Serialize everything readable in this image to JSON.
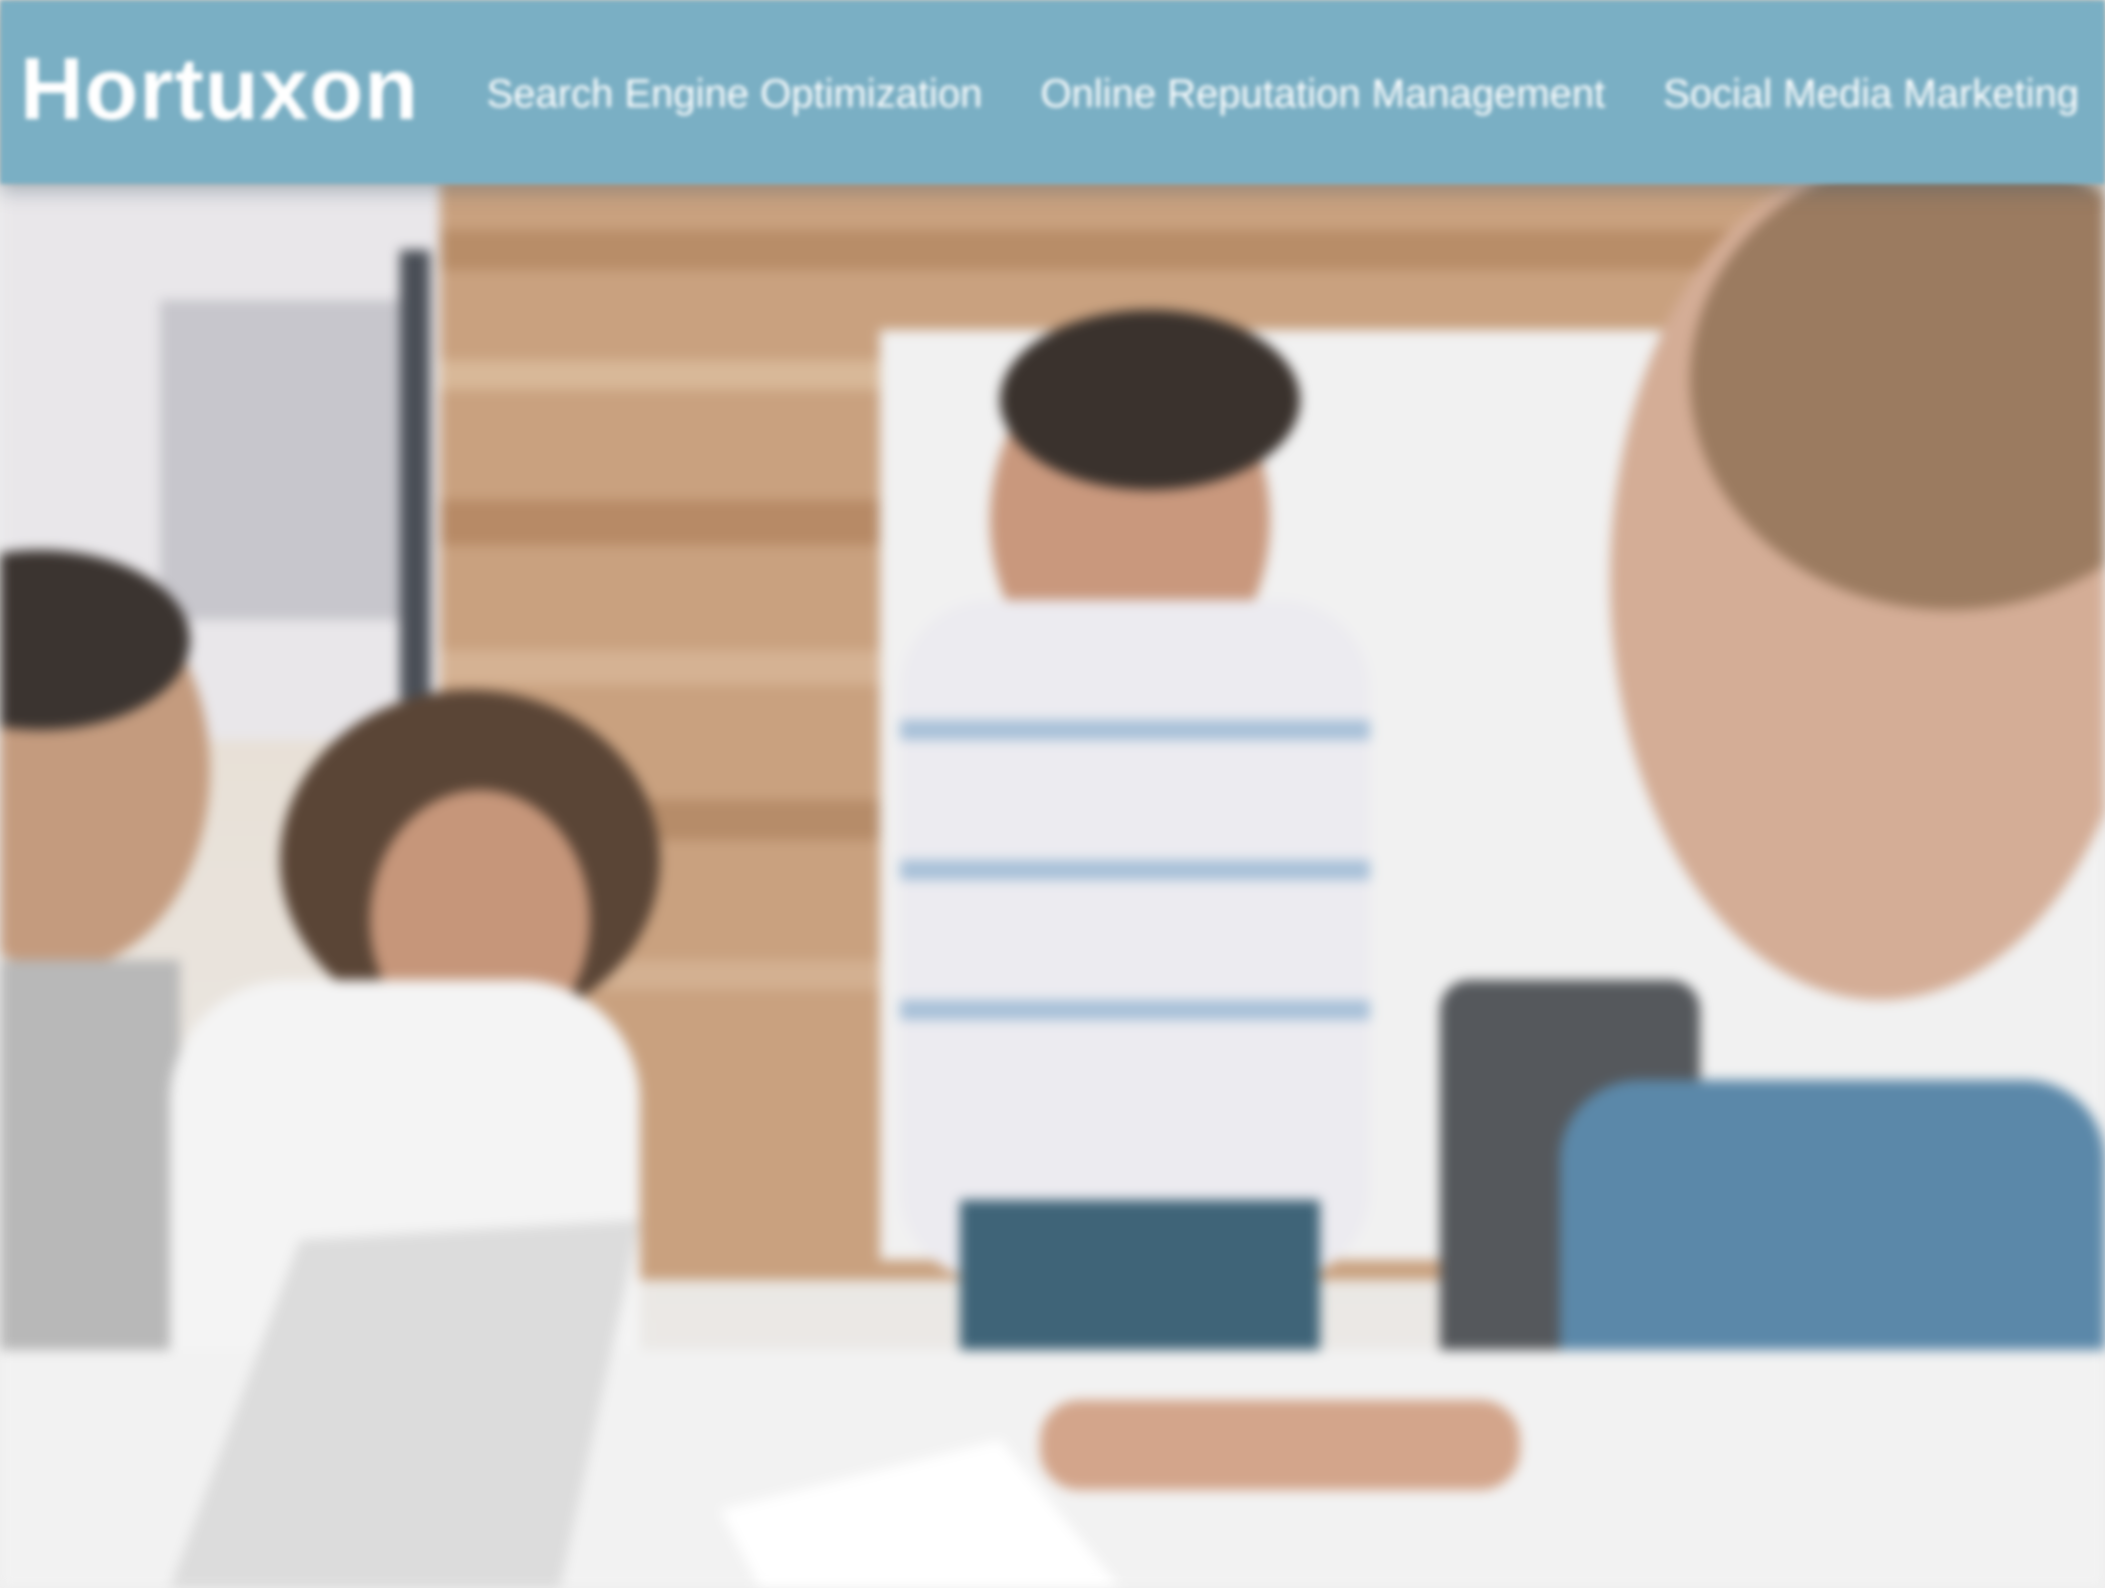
{
  "header": {
    "logo": "Hortuxon",
    "nav": [
      {
        "label": "Search Engine Optimization"
      },
      {
        "label": "Online Reputation Management"
      },
      {
        "label": "Social Media Marketing"
      }
    ]
  },
  "colors": {
    "header_bg": "#7aafc4",
    "text": "#ffffff"
  },
  "hero": {
    "image_subject": "team-meeting-photo"
  }
}
